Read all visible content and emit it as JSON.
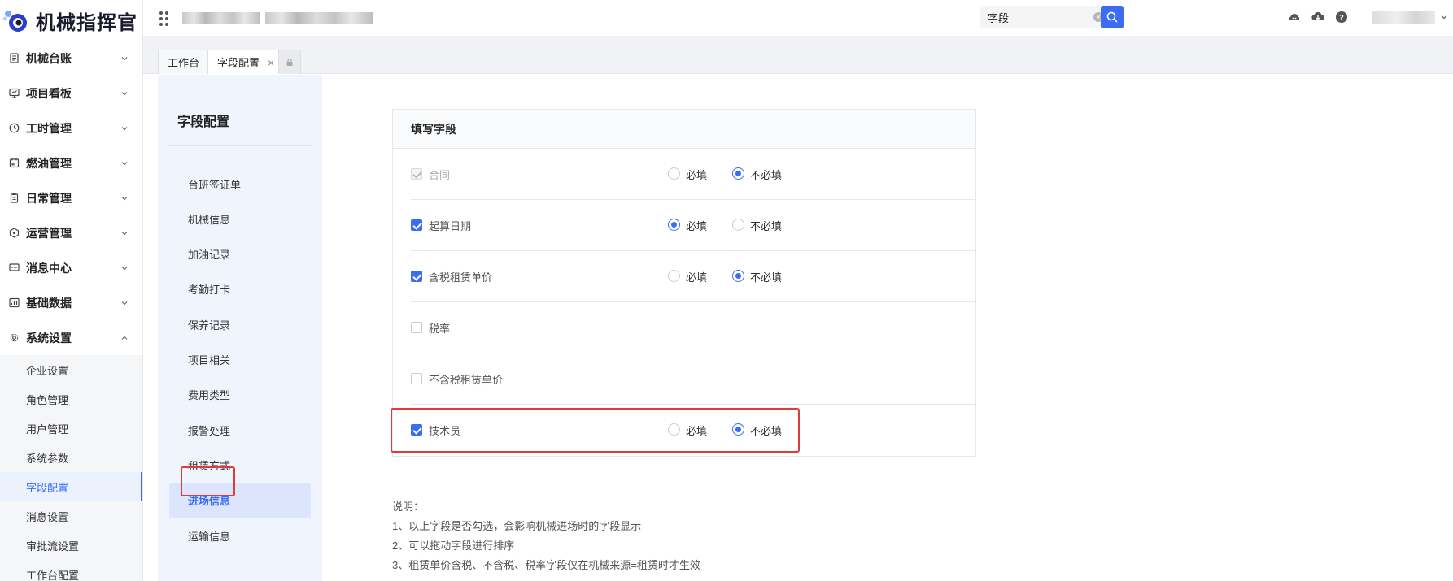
{
  "app": {
    "brand_name": "机械指挥官"
  },
  "sidebar": {
    "menus": [
      {
        "label": "机械台账",
        "icon": "ledger-icon",
        "expanded": false
      },
      {
        "label": "项目看板",
        "icon": "board-icon",
        "expanded": false
      },
      {
        "label": "工时管理",
        "icon": "clock-icon",
        "expanded": false
      },
      {
        "label": "燃油管理",
        "icon": "fuel-icon",
        "expanded": false
      },
      {
        "label": "日常管理",
        "icon": "clipboard-icon",
        "expanded": false
      },
      {
        "label": "运营管理",
        "icon": "operation-icon",
        "expanded": false
      },
      {
        "label": "消息中心",
        "icon": "message-icon",
        "expanded": false
      },
      {
        "label": "基础数据",
        "icon": "data-icon",
        "expanded": false
      },
      {
        "label": "系统设置",
        "icon": "gear-icon",
        "expanded": true
      }
    ],
    "system_submenu": [
      "企业设置",
      "角色管理",
      "用户管理",
      "系统参数",
      "字段配置",
      "消息设置",
      "审批流设置",
      "工作台配置"
    ],
    "active_submenu": "字段配置"
  },
  "topbar": {
    "search": {
      "value": "字段"
    }
  },
  "tabs": [
    {
      "label": "工作台",
      "active": false
    },
    {
      "label": "字段配置",
      "active": true,
      "closable": true
    }
  ],
  "config_nav": {
    "title": "字段配置",
    "items": [
      "台班签证单",
      "机械信息",
      "加油记录",
      "考勤打卡",
      "保养记录",
      "项目相关",
      "费用类型",
      "报警处理",
      "租赁方式",
      "进场信息",
      "运输信息"
    ],
    "active": "进场信息"
  },
  "fields_panel": {
    "title": "填写字段",
    "required_label": "必填",
    "optional_label": "不必填",
    "rows": [
      {
        "name": "合同",
        "checked": true,
        "disabled": true,
        "show_radio": true,
        "required": false
      },
      {
        "name": "起算日期",
        "checked": true,
        "disabled": false,
        "show_radio": true,
        "required": true
      },
      {
        "name": "含税租赁单价",
        "checked": true,
        "disabled": false,
        "show_radio": true,
        "required": false
      },
      {
        "name": "税率",
        "checked": false,
        "disabled": false,
        "show_radio": false
      },
      {
        "name": "不含税租赁单价",
        "checked": false,
        "disabled": false,
        "show_radio": false
      },
      {
        "name": "技术员",
        "checked": true,
        "disabled": false,
        "show_radio": true,
        "required": false
      }
    ]
  },
  "notes": {
    "title": "说明：",
    "lines": [
      "1、以上字段是否勾选，会影响机械进场时的字段显示",
      "2、可以拖动字段进行排序",
      "3、租赁单价含税、不含税、税率字段仅在机械来源=租赁时才生效"
    ]
  },
  "colors": {
    "primary": "#3b6cf6",
    "highlight_border": "#e03b3b"
  }
}
